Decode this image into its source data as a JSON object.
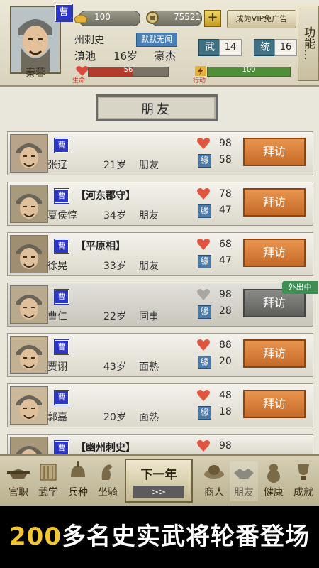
{
  "player": {
    "name": "秦蓉",
    "faction": "曹",
    "gold": "100",
    "coins": "75521",
    "vip_label": "成为VIP免广告",
    "position": "州刺史",
    "fame": "默默无闻",
    "location": "滇池",
    "age": "16岁",
    "class": "豪杰",
    "stat1_label": "武",
    "stat1_value": "14",
    "stat2_label": "统",
    "stat2_value": "16",
    "hp_label": "生命",
    "hp_value": "56",
    "hp_fraction": 0.56,
    "ap_label": "行动",
    "ap_value": "100",
    "ap_fraction": 1.0,
    "function_label": "功能…"
  },
  "friends_title": "朋友",
  "visit_label": "拜访",
  "out_badge": "外出中",
  "friends": [
    {
      "name": "张辽",
      "faction": "曹",
      "title": "",
      "age": "21岁",
      "relation": "朋友",
      "v1": "98",
      "v2": "58",
      "heart": "red",
      "available": true,
      "color": "#b8a48a"
    },
    {
      "name": "夏侯惇",
      "faction": "曹",
      "title": "【河东郡守】",
      "age": "34岁",
      "relation": "朋友",
      "v1": "78",
      "v2": "47",
      "heart": "red",
      "available": true,
      "color": "#a89a7c"
    },
    {
      "name": "徐晃",
      "faction": "曹",
      "title": "【平原相】",
      "age": "33岁",
      "relation": "朋友",
      "v1": "68",
      "v2": "47",
      "heart": "red",
      "available": true,
      "color": "#9f8e6f"
    },
    {
      "name": "曹仁",
      "faction": "曹",
      "title": "",
      "age": "22岁",
      "relation": "同事",
      "v1": "98",
      "v2": "28",
      "heart": "grey",
      "available": false,
      "color": "#b9aa8e"
    },
    {
      "name": "贾诩",
      "faction": "曹",
      "title": "",
      "age": "43岁",
      "relation": "面熟",
      "v1": "88",
      "v2": "20",
      "heart": "red",
      "available": true,
      "color": "#c2b193"
    },
    {
      "name": "郭嘉",
      "faction": "曹",
      "title": "",
      "age": "20岁",
      "relation": "面熟",
      "v1": "48",
      "v2": "18",
      "heart": "red",
      "available": true,
      "color": "#c9b89a"
    },
    {
      "name": "",
      "faction": "曹",
      "title": "【幽州刺史】",
      "age": "",
      "relation": "",
      "v1": "98",
      "v2": "",
      "heart": "red",
      "available": true,
      "color": "#a8987a"
    }
  ],
  "nav": {
    "official": "官职",
    "martial": "武学",
    "troops": "兵种",
    "mount": "坐骑",
    "next_year": "下一年",
    "next_arrows": ">>",
    "merchant": "商人",
    "friends": "朋友",
    "health": "健康",
    "achievement": "成就"
  },
  "banner": {
    "number": "200",
    "text": "多名史实武将轮番登场"
  },
  "colors": {
    "faction_blue": "#2b35c8",
    "visit_orange": "#d9803a",
    "hp_red": "#c0392b",
    "ap_green": "#3a9a3a"
  }
}
